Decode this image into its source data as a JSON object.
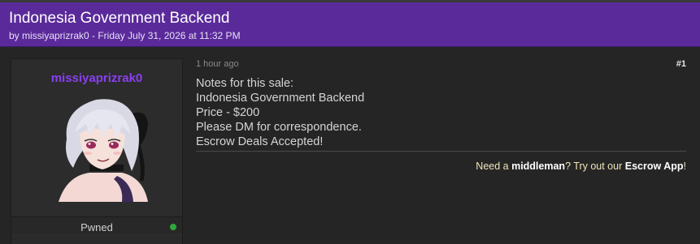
{
  "thread": {
    "title": "Indonesia Government Backend",
    "meta": "by missiyaprizrak0 - Friday July 31, 2026 at 11:32 PM"
  },
  "author": {
    "username": "missiyaprizrak0",
    "rank": "Pwned",
    "online_status_color": "#2ea83a"
  },
  "post": {
    "time": "1 hour ago",
    "number": "#1",
    "lines": [
      "Notes for this sale:",
      "Indonesia Government Backend",
      "Price - $200",
      "Please DM for correspondence.",
      "Escrow Deals Accepted!"
    ]
  },
  "signature": {
    "prefix": "Need a ",
    "middleman": "middleman",
    "mid": "? Try out our ",
    "escrow": "Escrow App",
    "suffix": "!"
  },
  "colors": {
    "header_bg": "#5a2a9a",
    "username": "#8a3ff0",
    "page_bg": "#252525"
  }
}
